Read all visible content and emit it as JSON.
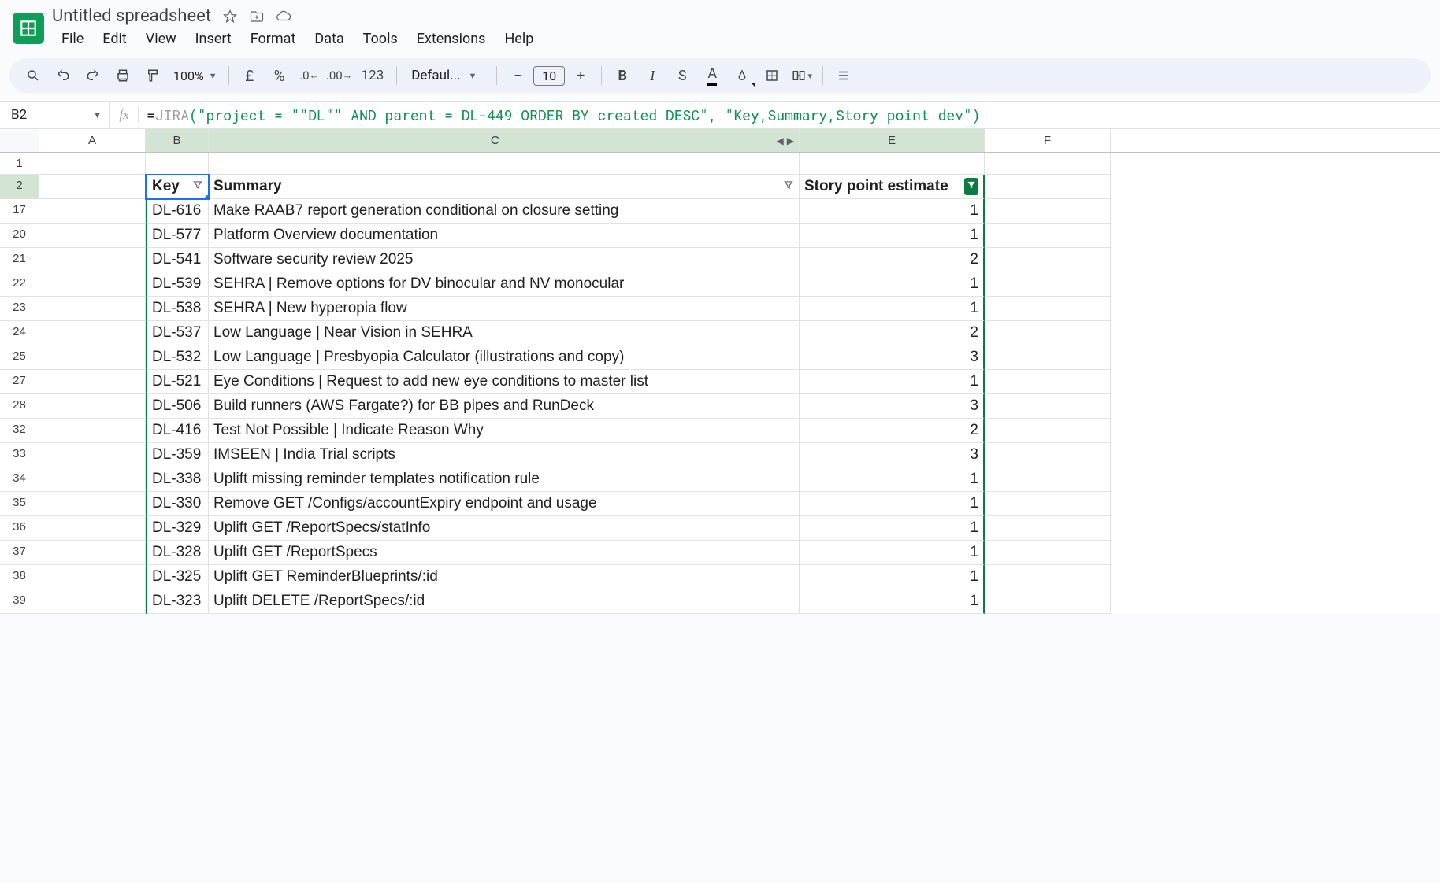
{
  "doc_title": "Untitled spreadsheet",
  "menu": [
    "File",
    "Edit",
    "View",
    "Insert",
    "Format",
    "Data",
    "Tools",
    "Extensions",
    "Help"
  ],
  "toolbar": {
    "zoom": "100%",
    "currency_symbol": "£",
    "percent_symbol": "%",
    "number_format": "123",
    "font_name": "Defaul...",
    "font_size": "10"
  },
  "name_box": "B2",
  "formula": {
    "prefix": "=",
    "fn": "JIRA",
    "args_display": "(\"project = \"\"DL\"\" AND parent = DL-449 ORDER BY created DESC\", \"Key,Summary,Story point dev\")"
  },
  "columns": [
    "A",
    "B",
    "C",
    "E",
    "F"
  ],
  "headers": {
    "key": "Key",
    "summary": "Summary",
    "sp": "Story point estimate"
  },
  "rows": [
    {
      "rn": 17,
      "key": "DL-616",
      "summary": "Make RAAB7 report generation conditional on closure setting",
      "sp": 1
    },
    {
      "rn": 20,
      "key": "DL-577",
      "summary": "Platform Overview documentation",
      "sp": 1
    },
    {
      "rn": 21,
      "key": "DL-541",
      "summary": "Software security review 2025",
      "sp": 2
    },
    {
      "rn": 22,
      "key": "DL-539",
      "summary": "SEHRA | Remove options for DV binocular and NV monocular",
      "sp": 1
    },
    {
      "rn": 23,
      "key": "DL-538",
      "summary": "SEHRA | New hyperopia flow",
      "sp": 1
    },
    {
      "rn": 24,
      "key": "DL-537",
      "summary": "Low Language | Near Vision in SEHRA",
      "sp": 2
    },
    {
      "rn": 25,
      "key": "DL-532",
      "summary": "Low Language | Presbyopia Calculator (illustrations and copy)",
      "sp": 3
    },
    {
      "rn": 27,
      "key": "DL-521",
      "summary": "Eye Conditions | Request to add new eye conditions to master list",
      "sp": 1
    },
    {
      "rn": 28,
      "key": "DL-506",
      "summary": "Build runners (AWS Fargate?) for BB pipes and RunDeck",
      "sp": 3
    },
    {
      "rn": 32,
      "key": "DL-416",
      "summary": "Test Not Possible | Indicate Reason Why",
      "sp": 2
    },
    {
      "rn": 33,
      "key": "DL-359",
      "summary": "IMSEEN | India Trial scripts",
      "sp": 3
    },
    {
      "rn": 34,
      "key": "DL-338",
      "summary": "Uplift missing reminder templates notification rule",
      "sp": 1
    },
    {
      "rn": 35,
      "key": "DL-330",
      "summary": "Remove GET /Configs/accountExpiry endpoint and usage",
      "sp": 1
    },
    {
      "rn": 36,
      "key": "DL-329",
      "summary": "Uplift GET /ReportSpecs/statInfo",
      "sp": 1
    },
    {
      "rn": 37,
      "key": "DL-328",
      "summary": "Uplift GET /ReportSpecs",
      "sp": 1
    },
    {
      "rn": 38,
      "key": "DL-325",
      "summary": "Uplift GET ReminderBlueprints/:id",
      "sp": 1
    },
    {
      "rn": 39,
      "key": "DL-323",
      "summary": "Uplift DELETE /ReportSpecs/:id",
      "sp": 1
    }
  ],
  "header_row_num": "2",
  "blank_row_num": "1"
}
